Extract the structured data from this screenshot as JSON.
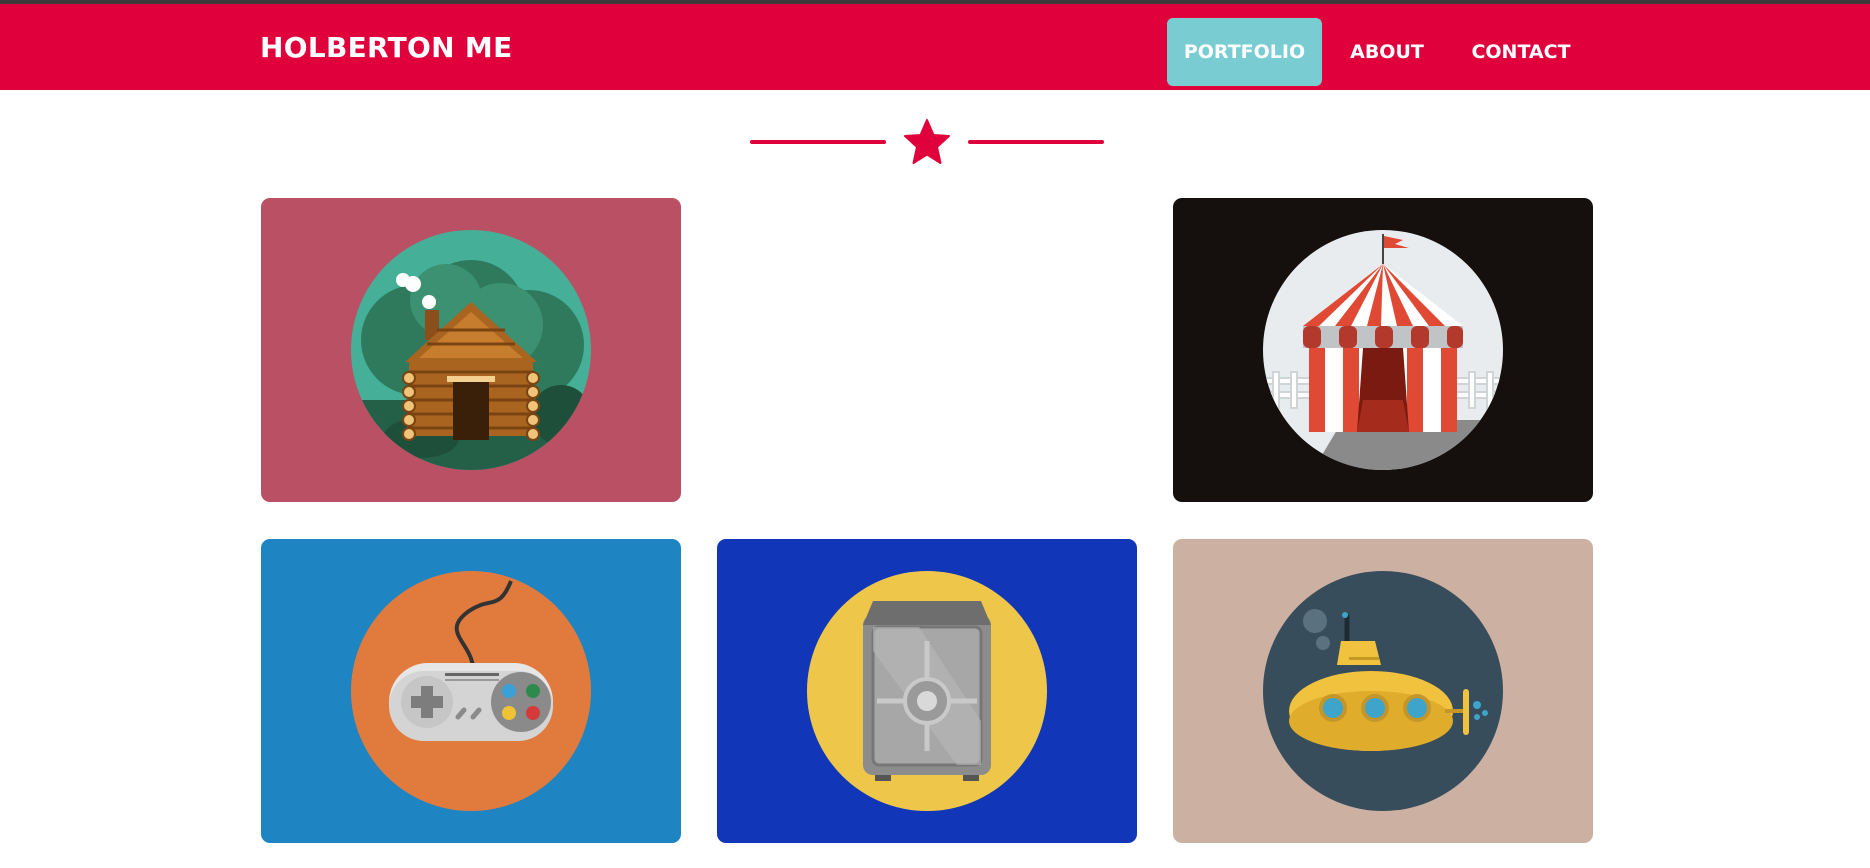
{
  "navbar": {
    "brand": "HOLBERTON ME",
    "links": [
      {
        "label": "PORTFOLIO",
        "active": true
      },
      {
        "label": "ABOUT",
        "active": false
      },
      {
        "label": "CONTACT",
        "active": false
      }
    ],
    "colors": {
      "bar": "#e0003c",
      "active_link": "#79cdd2",
      "text": "#ffffff"
    }
  },
  "divider": {
    "icon": "star-icon",
    "color": "#e0003c"
  },
  "portfolio": {
    "items": [
      {
        "illustration": "log-cabin-icon",
        "background": "#b95064",
        "circle": "#45b097"
      },
      {
        "illustration": null,
        "background": "#ffffff"
      },
      {
        "illustration": "circus-tent-icon",
        "background": "#15100e",
        "circle": "#e9ecee"
      },
      {
        "illustration": "game-controller-icon",
        "background": "#1e84c2",
        "circle": "#e17b3d"
      },
      {
        "illustration": "safe-icon",
        "background": "#1137b8",
        "circle": "#eec74a"
      },
      {
        "illustration": "submarine-icon",
        "background": "#ccb0a1",
        "circle": "#374d5c"
      }
    ]
  }
}
